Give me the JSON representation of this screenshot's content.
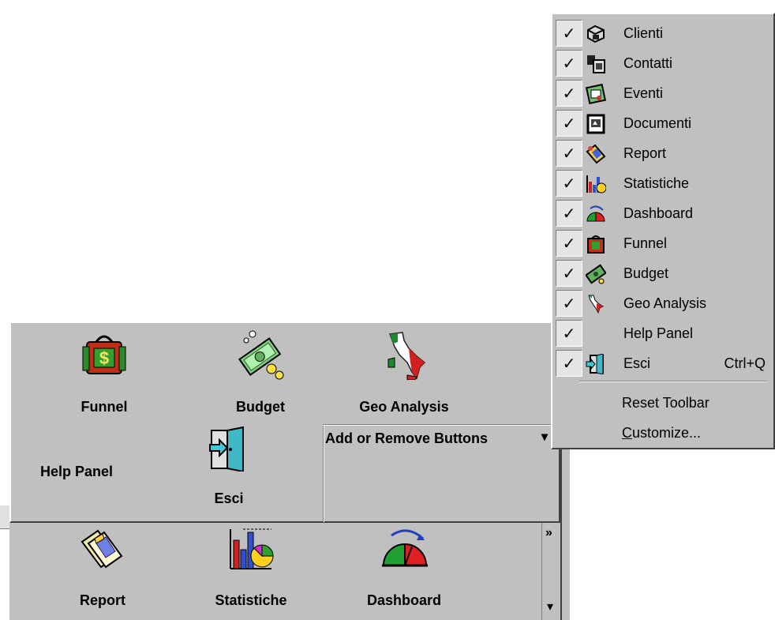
{
  "panel": {
    "buttons": [
      {
        "label": "Funnel",
        "icon": "funnel-moneybag-icon"
      },
      {
        "label": "Budget",
        "icon": "budget-money-icon"
      },
      {
        "label": "Geo Analysis",
        "icon": "italy-map-icon"
      },
      {
        "label": "Help Panel",
        "icon": ""
      },
      {
        "label": "Esci",
        "icon": "exit-door-icon"
      }
    ],
    "add_remove_label": "Add or Remove Buttons",
    "add_remove_arrow": "▾"
  },
  "bottombar": {
    "buttons": [
      {
        "label": "Report",
        "icon": "report-documents-icon"
      },
      {
        "label": "Statistiche",
        "icon": "statistics-chart-icon"
      },
      {
        "label": "Dashboard",
        "icon": "dashboard-gauge-icon"
      }
    ],
    "chevron": "»",
    "scroll_arrow": "▾"
  },
  "menu": {
    "items": [
      {
        "label": "Clienti",
        "checked": "✓",
        "icon": "clienti-icon",
        "shortcut": ""
      },
      {
        "label": "Contatti",
        "checked": "✓",
        "icon": "contatti-icon",
        "shortcut": ""
      },
      {
        "label": "Eventi",
        "checked": "✓",
        "icon": "eventi-icon",
        "shortcut": ""
      },
      {
        "label": "Documenti",
        "checked": "✓",
        "icon": "documenti-icon",
        "shortcut": ""
      },
      {
        "label": "Report",
        "checked": "✓",
        "icon": "report-icon",
        "shortcut": ""
      },
      {
        "label": "Statistiche",
        "checked": "✓",
        "icon": "statistiche-icon",
        "shortcut": ""
      },
      {
        "label": "Dashboard",
        "checked": "✓",
        "icon": "dashboard-icon",
        "shortcut": ""
      },
      {
        "label": "Funnel",
        "checked": "✓",
        "icon": "funnel-icon",
        "shortcut": ""
      },
      {
        "label": "Budget",
        "checked": "✓",
        "icon": "budget-icon",
        "shortcut": ""
      },
      {
        "label": "Geo Analysis",
        "checked": "✓",
        "icon": "geo-analysis-icon",
        "shortcut": ""
      },
      {
        "label": "Help Panel",
        "checked": "✓",
        "icon": "",
        "shortcut": ""
      },
      {
        "label": "Esci",
        "checked": "✓",
        "icon": "esci-icon",
        "shortcut": "Ctrl+Q"
      }
    ],
    "reset_label": "Reset Toolbar",
    "customize_first": "C",
    "customize_rest": "ustomize..."
  }
}
